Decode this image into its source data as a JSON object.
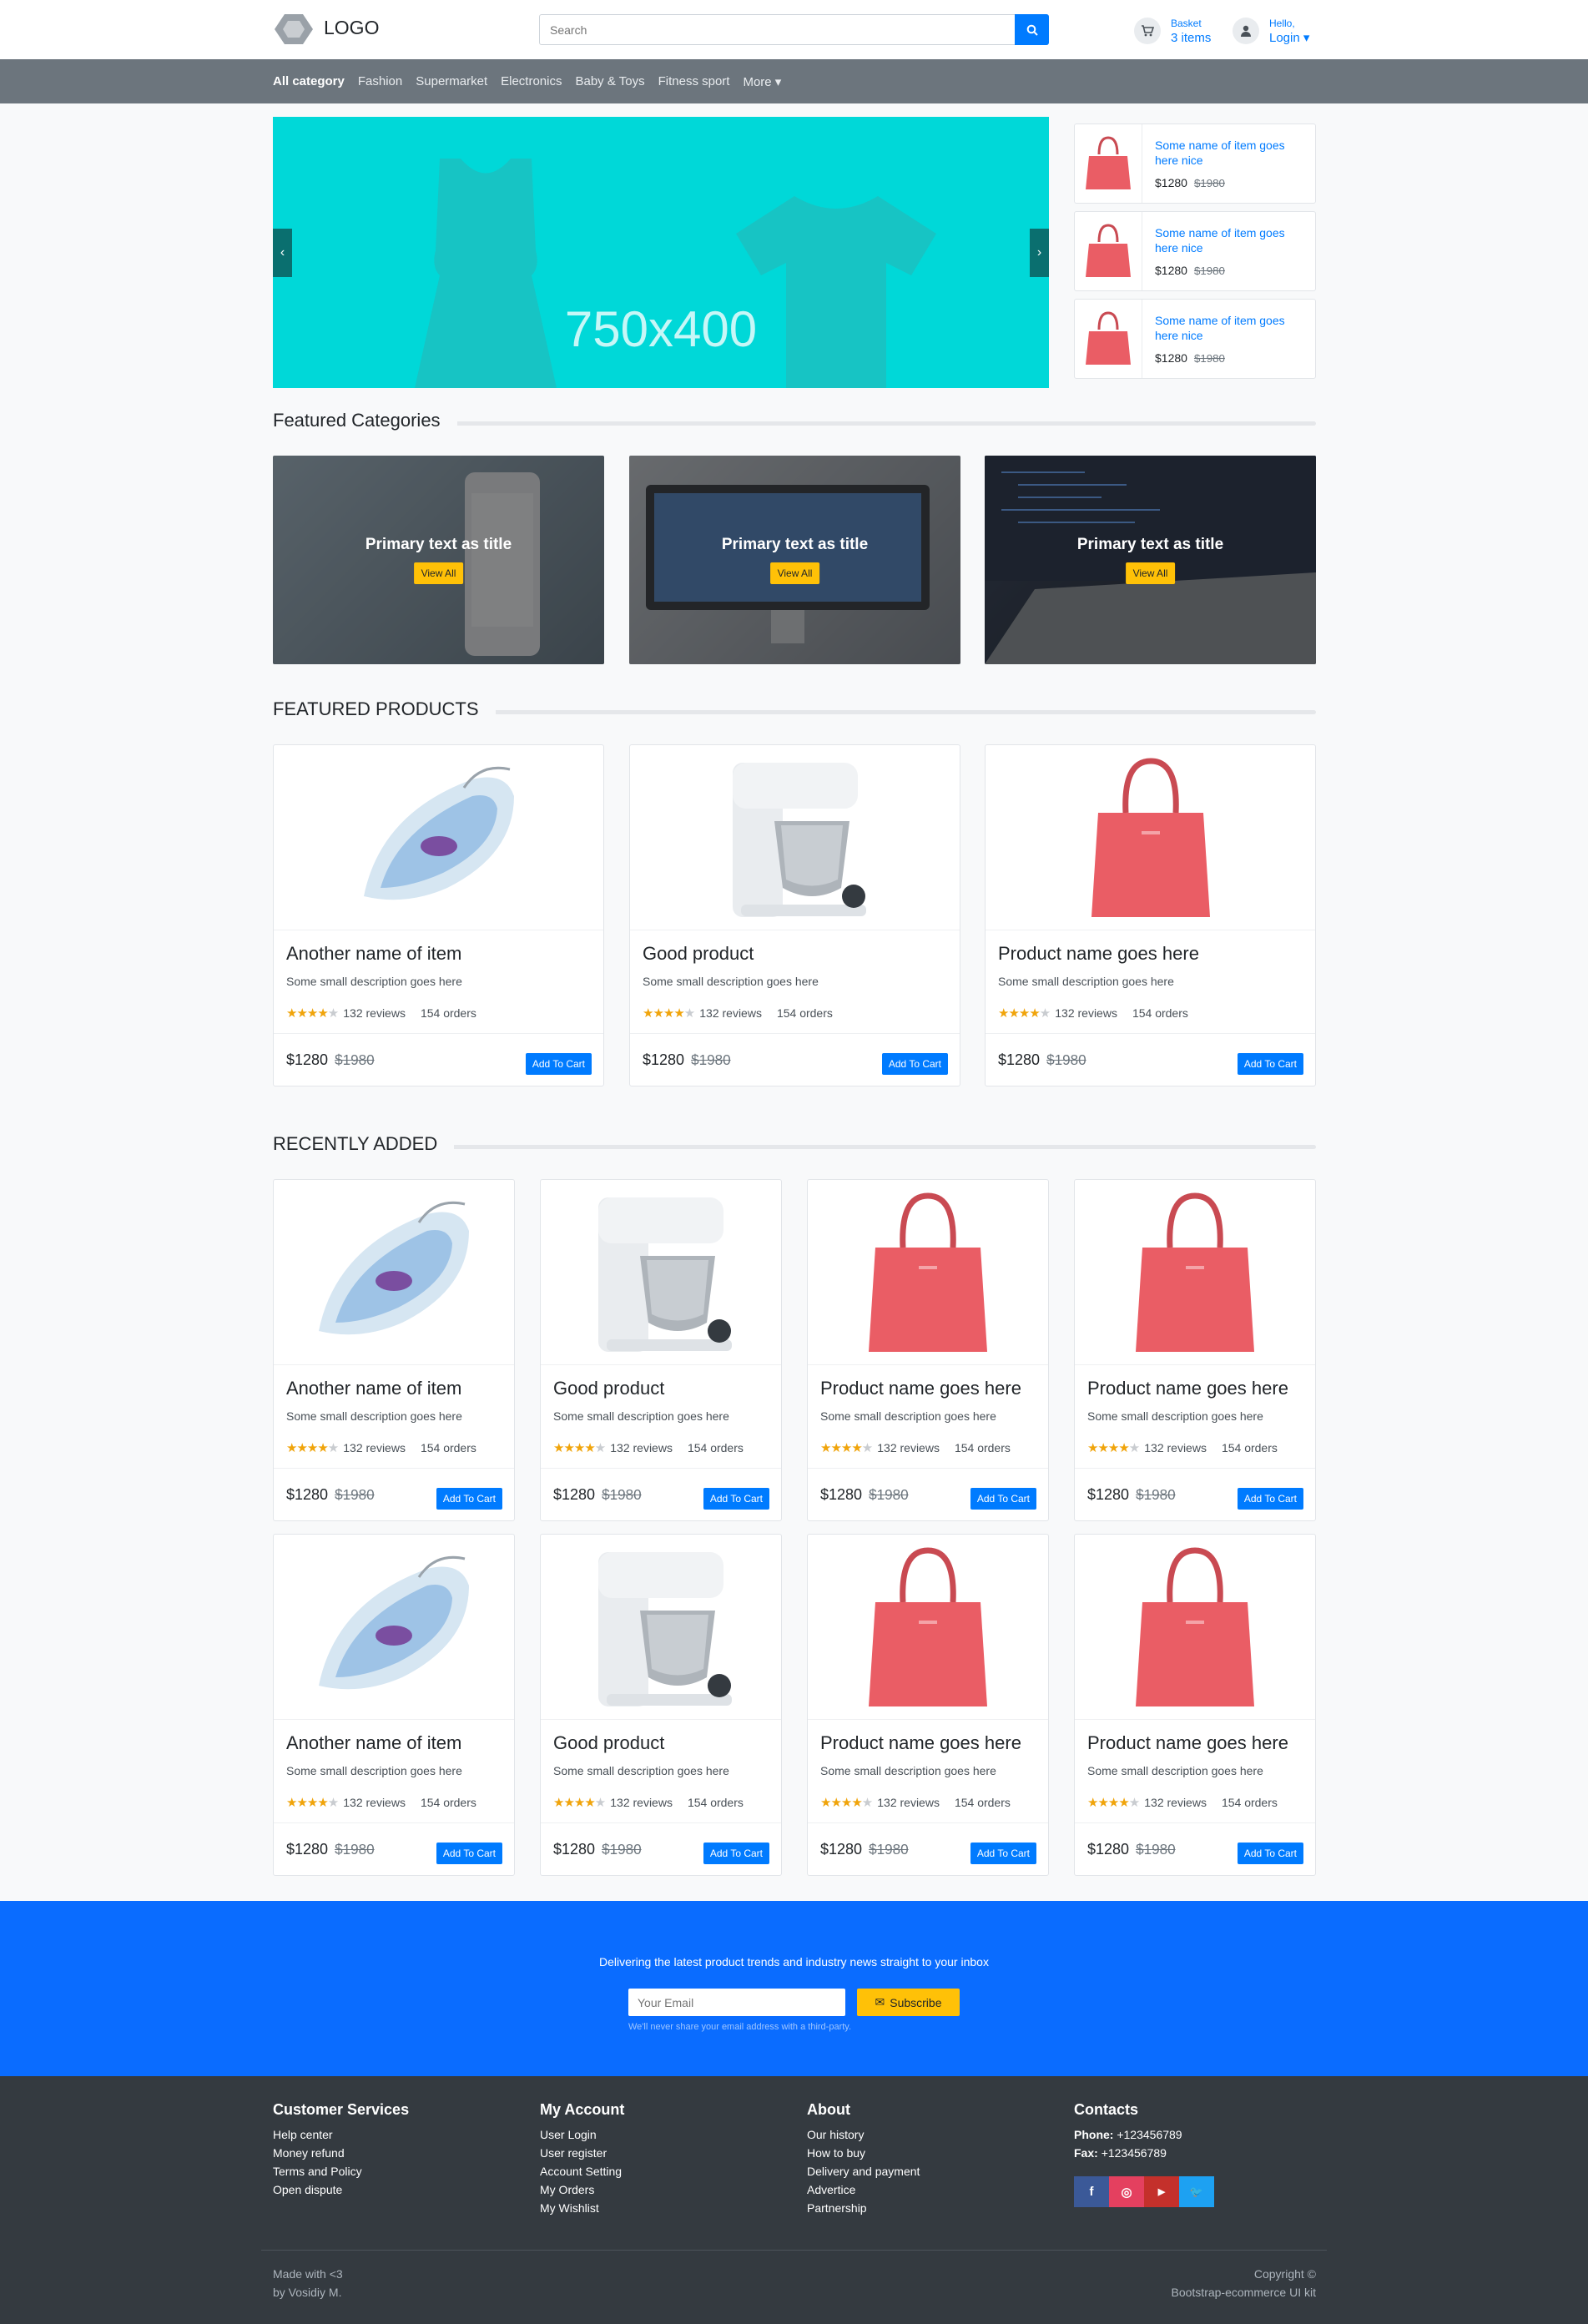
{
  "header": {
    "logo_text": "LOGO",
    "search_placeholder": "Search",
    "basket_label": "Basket",
    "basket_count": "3 items",
    "hello_label": "Hello,",
    "login_label": "Login ▾"
  },
  "nav": {
    "items": [
      "All category",
      "Fashion",
      "Supermarket",
      "Electronics",
      "Baby & Toys",
      "Fitness sport",
      "More ▾"
    ]
  },
  "banner": {
    "text": "750x400"
  },
  "side_items": [
    {
      "name": "Some name of item goes here nice",
      "price": "$1280",
      "old_price": "$1980"
    },
    {
      "name": "Some name of item goes here nice",
      "price": "$1280",
      "old_price": "$1980"
    },
    {
      "name": "Some name of item goes here nice",
      "price": "$1280",
      "old_price": "$1980"
    }
  ],
  "featured_categories": {
    "title": "Featured Categories",
    "cards": [
      {
        "title": "Primary text as title",
        "button": "View All"
      },
      {
        "title": "Primary text as title",
        "button": "View All"
      },
      {
        "title": "Primary text as title",
        "button": "View All"
      }
    ]
  },
  "featured_products": {
    "title": "FEATURED PRODUCTS",
    "items": [
      {
        "name": "Another name of item",
        "desc": "Some small description goes here",
        "rating": 4,
        "reviews": "132 reviews",
        "orders": "154 orders",
        "price": "$1280",
        "old_price": "$1980",
        "cart": "Add To Cart",
        "image": "iron"
      },
      {
        "name": "Good product",
        "desc": "Some small description goes here",
        "rating": 4,
        "reviews": "132 reviews",
        "orders": "154 orders",
        "price": "$1280",
        "old_price": "$1980",
        "cart": "Add To Cart",
        "image": "mixer"
      },
      {
        "name": "Product name goes here",
        "desc": "Some small description goes here",
        "rating": 4,
        "reviews": "132 reviews",
        "orders": "154 orders",
        "price": "$1280",
        "old_price": "$1980",
        "cart": "Add To Cart",
        "image": "bag"
      }
    ]
  },
  "recently_added": {
    "title": "RECENTLY ADDED",
    "items": [
      {
        "name": "Another name of item",
        "desc": "Some small description goes here",
        "rating": 4,
        "reviews": "132 reviews",
        "orders": "154 orders",
        "price": "$1280",
        "old_price": "$1980",
        "cart": "Add To Cart",
        "image": "iron"
      },
      {
        "name": "Good product",
        "desc": "Some small description goes here",
        "rating": 4,
        "reviews": "132 reviews",
        "orders": "154 orders",
        "price": "$1280",
        "old_price": "$1980",
        "cart": "Add To Cart",
        "image": "mixer"
      },
      {
        "name": "Product name goes here",
        "desc": "Some small description goes here",
        "rating": 4,
        "reviews": "132 reviews",
        "orders": "154 orders",
        "price": "$1280",
        "old_price": "$1980",
        "cart": "Add To Cart",
        "image": "bag"
      },
      {
        "name": "Product name goes here",
        "desc": "Some small description goes here",
        "rating": 4,
        "reviews": "132 reviews",
        "orders": "154 orders",
        "price": "$1280",
        "old_price": "$1980",
        "cart": "Add To Cart",
        "image": "bag"
      },
      {
        "name": "Another name of item",
        "desc": "Some small description goes here",
        "rating": 4,
        "reviews": "132 reviews",
        "orders": "154 orders",
        "price": "$1280",
        "old_price": "$1980",
        "cart": "Add To Cart",
        "image": "iron"
      },
      {
        "name": "Good product",
        "desc": "Some small description goes here",
        "rating": 4,
        "reviews": "132 reviews",
        "orders": "154 orders",
        "price": "$1280",
        "old_price": "$1980",
        "cart": "Add To Cart",
        "image": "mixer"
      },
      {
        "name": "Product name goes here",
        "desc": "Some small description goes here",
        "rating": 4,
        "reviews": "132 reviews",
        "orders": "154 orders",
        "price": "$1280",
        "old_price": "$1980",
        "cart": "Add To Cart",
        "image": "bag"
      },
      {
        "name": "Product name goes here",
        "desc": "Some small description goes here",
        "rating": 4,
        "reviews": "132 reviews",
        "orders": "154 orders",
        "price": "$1280",
        "old_price": "$1980",
        "cart": "Add To Cart",
        "image": "bag"
      }
    ]
  },
  "subscribe": {
    "text": "Delivering the latest product trends and industry news straight to your inbox",
    "placeholder": "Your Email",
    "button": "Subscribe",
    "note": "We'll never share your email address with a third-party."
  },
  "footer": {
    "columns": [
      {
        "title": "Customer Services",
        "links": [
          "Help center",
          "Money refund",
          "Terms and Policy",
          "Open dispute"
        ]
      },
      {
        "title": "My Account",
        "links": [
          "User Login",
          "User register",
          "Account Setting",
          "My Orders",
          "My Wishlist"
        ]
      },
      {
        "title": "About",
        "links": [
          "Our history",
          "How to buy",
          "Delivery and payment",
          "Advertice",
          "Partnership"
        ]
      }
    ],
    "contacts": {
      "title": "Contacts",
      "phone_label": "Phone:",
      "phone": "+123456789",
      "fax_label": "Fax:",
      "fax": "+123456789"
    },
    "social": [
      {
        "icon": "facebook-icon",
        "glyph": "f",
        "color": "#3b5998"
      },
      {
        "icon": "instagram-icon",
        "glyph": "◎",
        "color": "#e4405f"
      },
      {
        "icon": "youtube-icon",
        "glyph": "▶",
        "color": "#c4302b"
      },
      {
        "icon": "twitter-icon",
        "glyph": "🐦",
        "color": "#1da1f2"
      }
    ],
    "made_with": "Made with <3",
    "by": "by Vosidiy M.",
    "copyright": "Copyright ©",
    "kit": "Bootstrap-ecommerce UI kit"
  },
  "colors": {
    "primary": "#007bff",
    "accent": "#ffc107",
    "nav": "#6c757d",
    "footer": "#343a40",
    "subscribe": "#0a6cff"
  }
}
